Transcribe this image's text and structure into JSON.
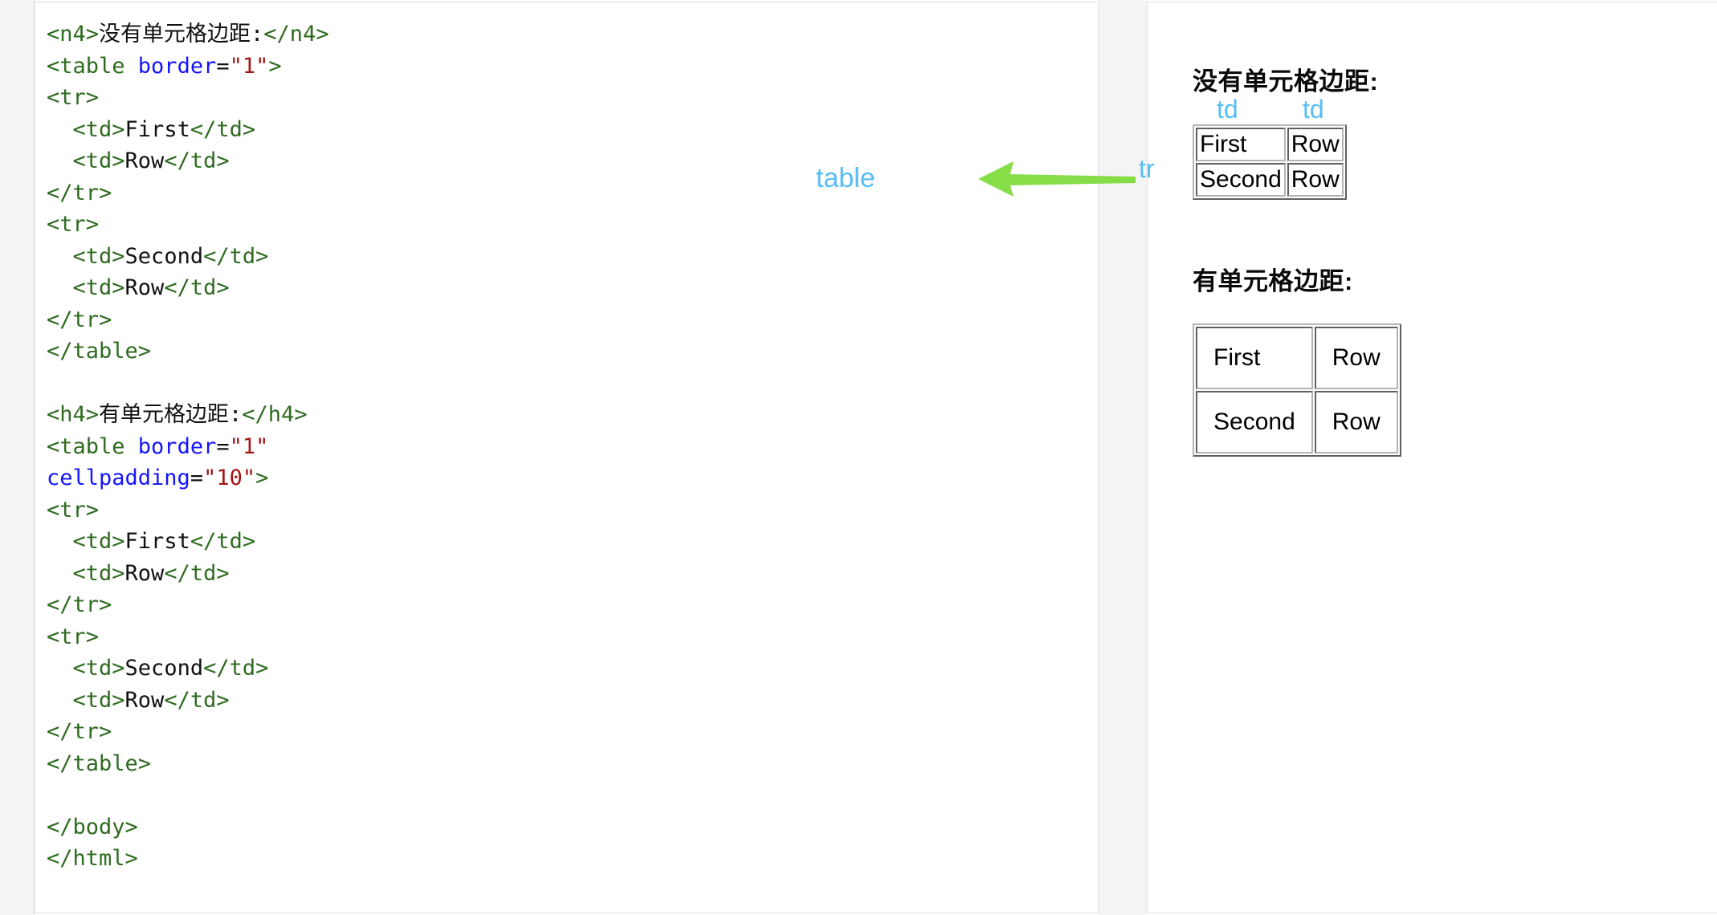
{
  "editor": {
    "name": "html-source-pane",
    "language": "html",
    "lines": [
      {
        "indent": 0,
        "tokens": [
          {
            "t": "tag",
            "v": "<n4>"
          },
          {
            "t": "txt",
            "v": "没有单元格边距:"
          },
          {
            "t": "tag",
            "v": "</n4>"
          }
        ]
      },
      {
        "indent": 0,
        "tokens": [
          {
            "t": "tag",
            "v": "<table "
          },
          {
            "t": "attr",
            "v": "border"
          },
          {
            "t": "eq",
            "v": "="
          },
          {
            "t": "val",
            "v": "\"1\""
          },
          {
            "t": "tag",
            "v": ">"
          }
        ]
      },
      {
        "indent": 0,
        "tokens": [
          {
            "t": "tag",
            "v": "<tr>"
          }
        ]
      },
      {
        "indent": 2,
        "tokens": [
          {
            "t": "tag",
            "v": "<td>"
          },
          {
            "t": "txt",
            "v": "First"
          },
          {
            "t": "tag",
            "v": "</td>"
          }
        ]
      },
      {
        "indent": 2,
        "tokens": [
          {
            "t": "tag",
            "v": "<td>"
          },
          {
            "t": "txt",
            "v": "Row"
          },
          {
            "t": "tag",
            "v": "</td>"
          }
        ]
      },
      {
        "indent": 0,
        "tokens": [
          {
            "t": "tag",
            "v": "</tr>"
          }
        ]
      },
      {
        "indent": 0,
        "tokens": [
          {
            "t": "tag",
            "v": "<tr>"
          }
        ]
      },
      {
        "indent": 2,
        "tokens": [
          {
            "t": "tag",
            "v": "<td>"
          },
          {
            "t": "txt",
            "v": "Second"
          },
          {
            "t": "tag",
            "v": "</td>"
          }
        ]
      },
      {
        "indent": 2,
        "tokens": [
          {
            "t": "tag",
            "v": "<td>"
          },
          {
            "t": "txt",
            "v": "Row"
          },
          {
            "t": "tag",
            "v": "</td>"
          }
        ]
      },
      {
        "indent": 0,
        "tokens": [
          {
            "t": "tag",
            "v": "</tr>"
          }
        ]
      },
      {
        "indent": 0,
        "tokens": [
          {
            "t": "tag",
            "v": "</table>"
          }
        ]
      },
      {
        "indent": 0,
        "tokens": []
      },
      {
        "indent": 0,
        "tokens": [
          {
            "t": "tag",
            "v": "<h4>"
          },
          {
            "t": "txt",
            "v": "有单元格边距:"
          },
          {
            "t": "tag",
            "v": "</h4>"
          }
        ]
      },
      {
        "indent": 0,
        "tokens": [
          {
            "t": "tag",
            "v": "<table "
          },
          {
            "t": "attr",
            "v": "border"
          },
          {
            "t": "eq",
            "v": "="
          },
          {
            "t": "val",
            "v": "\"1\""
          }
        ]
      },
      {
        "indent": 0,
        "tokens": [
          {
            "t": "attr",
            "v": "cellpadding"
          },
          {
            "t": "eq",
            "v": "="
          },
          {
            "t": "val",
            "v": "\"10\""
          },
          {
            "t": "tag",
            "v": ">"
          }
        ]
      },
      {
        "indent": 0,
        "tokens": [
          {
            "t": "tag",
            "v": "<tr>"
          }
        ]
      },
      {
        "indent": 2,
        "tokens": [
          {
            "t": "tag",
            "v": "<td>"
          },
          {
            "t": "txt",
            "v": "First"
          },
          {
            "t": "tag",
            "v": "</td>"
          }
        ]
      },
      {
        "indent": 2,
        "tokens": [
          {
            "t": "tag",
            "v": "<td>"
          },
          {
            "t": "txt",
            "v": "Row"
          },
          {
            "t": "tag",
            "v": "</td>"
          }
        ]
      },
      {
        "indent": 0,
        "tokens": [
          {
            "t": "tag",
            "v": "</tr>"
          }
        ]
      },
      {
        "indent": 0,
        "tokens": [
          {
            "t": "tag",
            "v": "<tr>"
          }
        ]
      },
      {
        "indent": 2,
        "tokens": [
          {
            "t": "tag",
            "v": "<td>"
          },
          {
            "t": "txt",
            "v": "Second"
          },
          {
            "t": "tag",
            "v": "</td>"
          }
        ]
      },
      {
        "indent": 2,
        "tokens": [
          {
            "t": "tag",
            "v": "<td>"
          },
          {
            "t": "txt",
            "v": "Row"
          },
          {
            "t": "tag",
            "v": "</td>"
          }
        ]
      },
      {
        "indent": 0,
        "tokens": [
          {
            "t": "tag",
            "v": "</tr>"
          }
        ]
      },
      {
        "indent": 0,
        "tokens": [
          {
            "t": "tag",
            "v": "</table>"
          }
        ]
      },
      {
        "indent": 0,
        "tokens": []
      },
      {
        "indent": 0,
        "tokens": [
          {
            "t": "tag",
            "v": "</body>"
          }
        ]
      },
      {
        "indent": 0,
        "tokens": [
          {
            "t": "tag",
            "v": "</html>"
          }
        ]
      }
    ]
  },
  "preview": {
    "name": "rendered-output-pane",
    "sections": [
      {
        "heading": "没有单元格边距:",
        "table": {
          "cellpadding": "0",
          "border": "1",
          "rows": [
            [
              "First",
              "Row"
            ],
            [
              "Second",
              "Row"
            ]
          ]
        }
      },
      {
        "heading": "有单元格边距:",
        "table": {
          "cellpadding": "10",
          "border": "1",
          "rows": [
            [
              "First",
              "Row"
            ],
            [
              "Second",
              "Row"
            ]
          ]
        }
      }
    ]
  },
  "annotations": {
    "table_label": "table",
    "tr_label": "tr",
    "td_label_left": "td",
    "td_label_right": "td",
    "arrow": {
      "icon": "arrow-left-icon",
      "direction": "left",
      "color": "#85de47"
    }
  },
  "colors": {
    "tag": "#2e6b1f",
    "attribute": "#1414ff",
    "attribute_value": "#a31515",
    "text_content": "#111111",
    "annotation_blue": "#56bdf5",
    "arrow_green": "#85de47",
    "page_background": "#f4f4f4",
    "card_background": "#ffffff",
    "card_border": "#e0e0e0"
  }
}
